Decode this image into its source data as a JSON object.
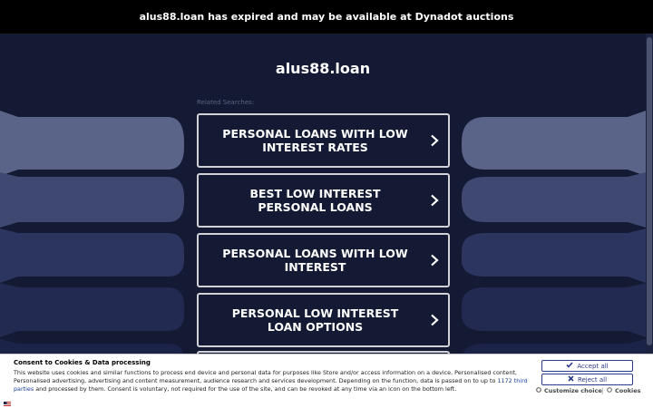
{
  "banner": {
    "text": "alus88.loan has expired and may be available at Dynadot auctions"
  },
  "page": {
    "domain": "alus88.loan",
    "related_label": "Related Searches:"
  },
  "results": [
    {
      "label": "PERSONAL LOANS WITH LOW INTEREST RATES"
    },
    {
      "label": "BEST LOW INTEREST PERSONAL LOANS"
    },
    {
      "label": "PERSONAL LOANS WITH LOW INTEREST"
    },
    {
      "label": "PERSONAL LOW INTEREST LOAN OPTIONS"
    }
  ],
  "consent": {
    "title": "Consent to Cookies & Data processing",
    "text_before": "This website uses cookies and similar functions to process end device and personal data for purposes like Store and/or access information on a device, Personalised content, Personalised advertising, advertising and content measurement, audience research and services development. Depending on the function, data is passed on to up to ",
    "link": "1172 third parties",
    "text_after": " and processed by them. Consent is voluntary, not required for the use of the site, and can be revoked at any time via an icon on the bottom left.",
    "accept": "Accept all",
    "reject": "Reject all",
    "customize": "Customize choice",
    "separator": "|",
    "cookies": "Cookies"
  },
  "colors": {
    "background": "#141a33",
    "banner": "#000000",
    "button_border": "#2b3a8a",
    "link": "#1a3fa0"
  },
  "icons": [
    "chevron-right-icon",
    "check-icon",
    "x-icon",
    "gear-icon",
    "cookie-icon",
    "flag-icon"
  ]
}
